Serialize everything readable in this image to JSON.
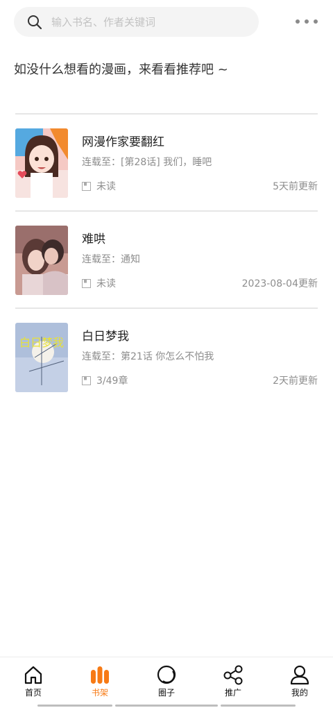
{
  "search": {
    "placeholder": "输入书名、作者关键词",
    "icon": "search-icon"
  },
  "more_icon": "more-dots-icon",
  "recommend_tip": "如没什么想看的漫画，来看看推荐吧 ~",
  "bookshelf": [
    {
      "title": "网漫作家要翻红",
      "latest": "连载至：[第28话] 我们，睡吧",
      "progress": "未读",
      "updated": "5天前更新"
    },
    {
      "title": "难哄",
      "latest": "连载至：通知",
      "progress": "未读",
      "updated": "2023-08-04更新"
    },
    {
      "title": "白日梦我",
      "latest": "连载至：第21话 你怎么不怕我",
      "progress": "3/49章",
      "updated": "2天前更新"
    }
  ],
  "cover_texts": {
    "c3_title": "白日梦我"
  },
  "nav": [
    {
      "label": "首页",
      "icon": "home-icon",
      "active": false
    },
    {
      "label": "书架",
      "icon": "bookshelf-icon",
      "active": true
    },
    {
      "label": "圈子",
      "icon": "circle-icon",
      "active": false
    },
    {
      "label": "推广",
      "icon": "share-icon",
      "active": false
    },
    {
      "label": "我的",
      "icon": "user-icon",
      "active": false
    }
  ],
  "colors": {
    "accent": "#f77a14",
    "text_secondary": "#8d8d8d",
    "divider": "#e6e6e6"
  }
}
